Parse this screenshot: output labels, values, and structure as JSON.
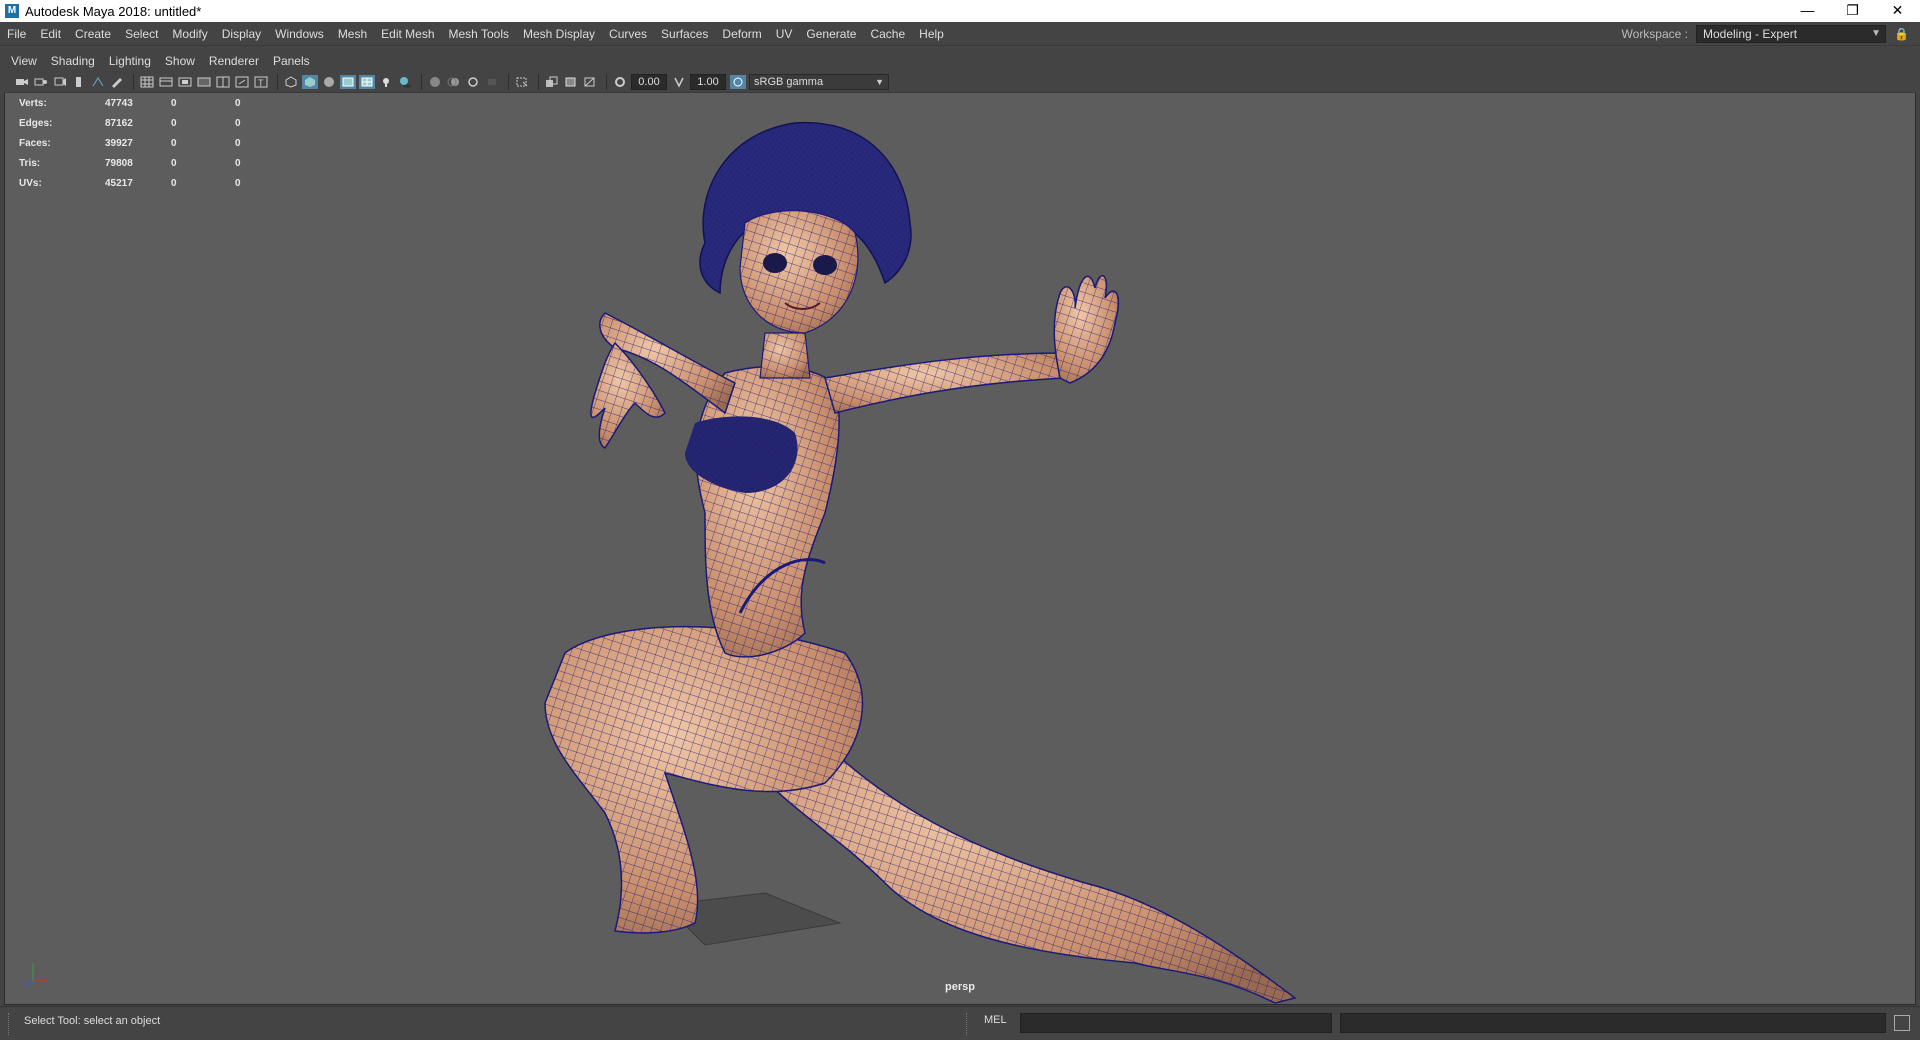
{
  "window": {
    "title": "Autodesk Maya 2018: untitled*",
    "logo_letter": "M",
    "minimize": "—",
    "restore": "❐",
    "close": "✕"
  },
  "menubar": {
    "items": [
      "File",
      "Edit",
      "Create",
      "Select",
      "Modify",
      "Display",
      "Windows",
      "Mesh",
      "Edit Mesh",
      "Mesh Tools",
      "Mesh Display",
      "Curves",
      "Surfaces",
      "Deform",
      "UV",
      "Generate",
      "Cache",
      "Help"
    ],
    "workspace_label": "Workspace :",
    "workspace_value": "Modeling - Expert"
  },
  "panel_menu": {
    "items": [
      "View",
      "Shading",
      "Lighting",
      "Show",
      "Renderer",
      "Panels"
    ]
  },
  "panel_toolbar": {
    "exposure": "0.00",
    "gamma": "1.00",
    "color_space": "sRGB gamma"
  },
  "hud": {
    "rows": [
      {
        "label": "Verts:",
        "v1": "47743",
        "v2": "0",
        "v3": "0"
      },
      {
        "label": "Edges:",
        "v1": "87162",
        "v2": "0",
        "v3": "0"
      },
      {
        "label": "Faces:",
        "v1": "39927",
        "v2": "0",
        "v3": "0"
      },
      {
        "label": "Tris:",
        "v1": "79808",
        "v2": "0",
        "v3": "0"
      },
      {
        "label": "UVs:",
        "v1": "45217",
        "v2": "0",
        "v3": "0"
      }
    ]
  },
  "viewport": {
    "camera": "persp",
    "wire_color": "#1a1a7a",
    "skin_color": "#c98e6c"
  },
  "command_line": {
    "status": "Select Tool: select an object",
    "language": "MEL"
  }
}
